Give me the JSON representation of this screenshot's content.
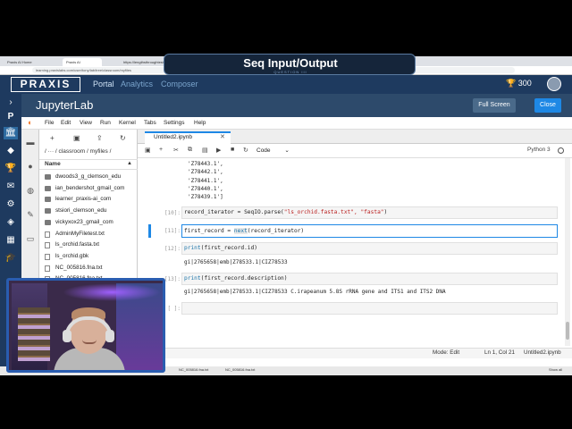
{
  "overlay": {
    "title": "Seq Input/Output",
    "subtitle": "QUESTION III"
  },
  "browser": {
    "tabs": [
      "Praxis AI Home",
      "Praxis AI",
      "https://lengthsthroughtestedstick..."
    ],
    "url": "learning.praxislabs.com/user/tony/lab/tree/classroom/myfiles"
  },
  "praxis": {
    "logo": "PRAXIS",
    "nav": [
      "Portal",
      "Analytics",
      "Composer"
    ],
    "points": "300"
  },
  "jupyter": {
    "title": "JupyterLab",
    "fullscreen_label": "Full Screen",
    "close_label": "Close",
    "menus": [
      "File",
      "Edit",
      "View",
      "Run",
      "Kernel",
      "Tabs",
      "Settings",
      "Help"
    ]
  },
  "filebrowser": {
    "breadcrumb": "/ ··· / classroom / myfiles /",
    "name_header": "Name",
    "items": [
      {
        "name": "dwoods3_g_clemson_edu",
        "type": "folder"
      },
      {
        "name": "ian_bendershot_gmail_com",
        "type": "folder"
      },
      {
        "name": "learner_praxis-ai_com",
        "type": "folder"
      },
      {
        "name": "stsiori_clemson_edu",
        "type": "folder"
      },
      {
        "name": "vickyxox23_gmail_com",
        "type": "folder"
      },
      {
        "name": "AdminMyFiletest.txt",
        "type": "file"
      },
      {
        "name": "ls_orchid.fasta.txt",
        "type": "file"
      },
      {
        "name": "ls_orchid.gbk",
        "type": "file"
      },
      {
        "name": "NC_005816.fna.txt",
        "type": "file"
      },
      {
        "name": "NC_005816.fna.txt",
        "type": "file"
      }
    ]
  },
  "notebook": {
    "tab_label": "Untitled2.ipynb",
    "cell_type": "Code",
    "kernel": "Python 3",
    "prev_output": [
      "'Z78444.1',",
      "'Z78443.1',",
      "'Z78442.1',",
      "'Z78441.1',",
      "'Z78440.1',",
      "'Z78439.1']"
    ],
    "cells": [
      {
        "prompt": "[10]:",
        "code_a": "record_iterator = ",
        "code_b": "SeqIO.parse(",
        "code_str": "\"ls_orchid.fasta.txt\", \"fasta\"",
        "code_c": ")"
      },
      {
        "prompt": "[11]:",
        "code_a": "first_record = ",
        "code_b": "next",
        "code_c": "(record_iterator)"
      },
      {
        "prompt": "[12]:",
        "code_a": "print",
        "code_c": "(first_record.id)",
        "output": "gi|2765658|emb|Z78533.1|CIZ78533"
      },
      {
        "prompt": "[13]:",
        "code_a": "print",
        "code_c": "(first_record.description)",
        "output": "gi|2765658|emb|Z78533.1|CIZ78533 C.irapeanum 5.8S rRNA gene and ITS1 and ITS2 DNA"
      },
      {
        "prompt": "[ ]:"
      }
    ]
  },
  "status": {
    "mode": "Mode: Edit",
    "position": "Ln 1, Col 21",
    "file": "Untitled2.ipynb"
  },
  "taskbar": [
    "NC_005816.fna.txt",
    "NC_005816.fna.txt",
    "Show all"
  ]
}
